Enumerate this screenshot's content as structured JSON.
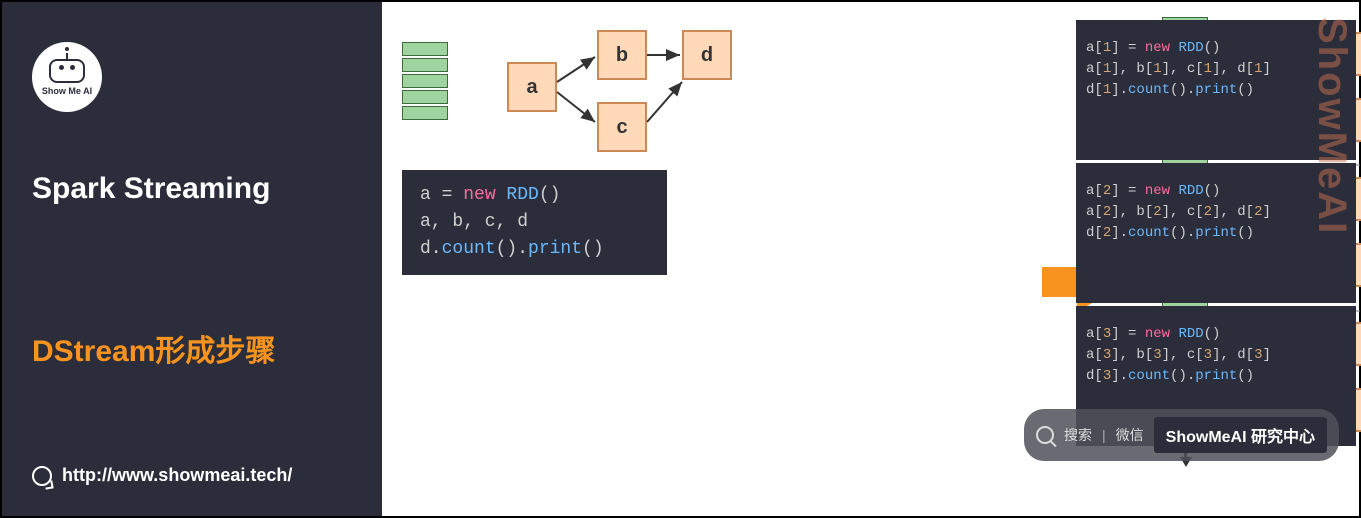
{
  "sidebar": {
    "logo_text": "Show Me AI",
    "title": "Spark Streaming",
    "subtitle": "DStream形成步骤",
    "footer_url": "http://www.showmeai.tech/"
  },
  "left_dag": {
    "a": "a",
    "b": "b",
    "c": "c",
    "d": "d"
  },
  "left_code": {
    "l1_var": "a",
    "l1_eq": " = ",
    "l1_kw": "new",
    "l1_fn": " RDD",
    "l1_paren": "()",
    "l2": "a, b, c, d",
    "l3_var": "d.",
    "l3_fn1": "count",
    "l3_p1": "().",
    "l3_fn2": "print",
    "l3_p2": "()"
  },
  "rows": [
    {
      "i": "1",
      "a": "a",
      "b": "b",
      "c": "c",
      "d": "d"
    },
    {
      "i": "2",
      "a": "a",
      "b": "b",
      "c": "c",
      "d": "d"
    },
    {
      "i": "3",
      "a": "a",
      "b": "b",
      "c": "c",
      "d": "d"
    }
  ],
  "right_code": [
    {
      "l1a": "a[",
      "l1n": "1",
      "l1b": "] = ",
      "l1kw": "new",
      "l1fn": " RDD",
      "l1p": "()",
      "l2a": "a[",
      "l2n1": "1",
      "l2b": "], b[",
      "l2n2": "1",
      "l2c": "], c[",
      "l2n3": "1",
      "l2d": "], d[",
      "l2n4": "1",
      "l2e": "]",
      "l3a": "d[",
      "l3n": "1",
      "l3b": "].",
      "l3f1": "count",
      "l3p1": "().",
      "l3f2": "print",
      "l3p2": "()"
    },
    {
      "l1a": "a[",
      "l1n": "2",
      "l1b": "] = ",
      "l1kw": "new",
      "l1fn": " RDD",
      "l1p": "()",
      "l2a": "a[",
      "l2n1": "2",
      "l2b": "], b[",
      "l2n2": "2",
      "l2c": "], c[",
      "l2n3": "2",
      "l2d": "], d[",
      "l2n4": "2",
      "l2e": "]",
      "l3a": "d[",
      "l3n": "2",
      "l3b": "].",
      "l3f1": "count",
      "l3p1": "().",
      "l3f2": "print",
      "l3p2": "()"
    },
    {
      "l1a": "a[",
      "l1n": "3",
      "l1b": "] = ",
      "l1kw": "new",
      "l1fn": " RDD",
      "l1p": "()",
      "l2a": "a[",
      "l2n1": "3",
      "l2b": "], b[",
      "l2n2": "3",
      "l2c": "], c[",
      "l2n3": "3",
      "l2d": "], d[",
      "l2n4": "3",
      "l2e": "]",
      "l3a": "d[",
      "l3n": "3",
      "l3b": "].",
      "l3f1": "count",
      "l3p1": "().",
      "l3f2": "print",
      "l3p2": "()"
    }
  ],
  "watermark": "ShowMeAI",
  "search": {
    "placeholder": "搜索",
    "hint": "微信",
    "badge": "ShowMeAI 研究中心"
  }
}
